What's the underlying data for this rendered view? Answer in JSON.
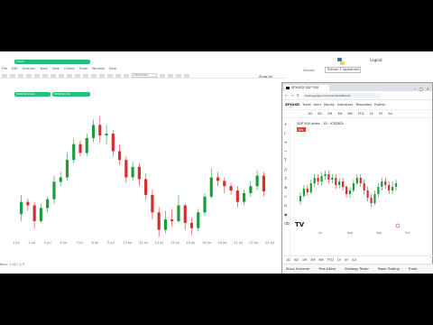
{
  "left_app": {
    "menu": [
      "File",
      "Edit",
      "Analysis",
      "Tools",
      "View",
      "Charts",
      "Trade",
      "Window",
      "Help"
    ],
    "interval_select": "Interactive",
    "show_all": "Show All",
    "pills": [
      "Chart",
      "EURUSD,Daily",
      "EURUSD,H4"
    ],
    "x_axis": [
      "1 Jul",
      "2 Jul",
      "5 Jul",
      "6 Jul",
      "7 Jul",
      "8 Jul",
      "9 Jul",
      "12 Jul",
      "13 Jul",
      "14 Jul",
      "15 Jul",
      "16 Jul",
      "19 Jul",
      "20 Jul",
      "21 Jul",
      "22 Jul",
      "23 Jul"
    ],
    "status": "Bars: 1.02 / 1.9"
  },
  "py_app": {
    "logout": "Logout",
    "label": "Session",
    "field_value": "Python 3 (ipykernel)"
  },
  "browser": {
    "tab_title": "SPXUSD S&P 500",
    "url": "tradingview.com/chart/4Oz9Ezu3/",
    "tv_symbol": "SPXUSD",
    "tv_header": [
      "Trade",
      "Alert",
      "Replay",
      "Indicators",
      "Templates",
      "Publish"
    ],
    "intervals": [
      "1D",
      "5D",
      "1M",
      "3M",
      "6M",
      "YTD",
      "1Y",
      "5Y",
      "All"
    ],
    "symbol_line": "S&P 500 Index · 1D · ICEDATA",
    "badge": "Sell",
    "x_labels": [
      "Jul",
      "Aug",
      "Sep",
      "Oct"
    ],
    "bottom_bar": [
      "1D",
      "5D",
      "1M",
      "3M",
      "6M",
      "YTD",
      "1Y",
      "5Y",
      "All"
    ],
    "footer": [
      "Stock Screener",
      "Pine Editor",
      "Strategy Tester",
      "Paper Trading",
      "Trade"
    ]
  },
  "colors": {
    "up": "#1a9c3f",
    "down": "#d32f2f",
    "pill": "#22c07a",
    "accent": "#2962ff"
  },
  "chart_data": [
    {
      "type": "candlestick",
      "name": "left-desktop-chart",
      "candles": [
        {
          "o": 38,
          "c": 52,
          "h": 60,
          "l": 30
        },
        {
          "o": 52,
          "c": 48,
          "h": 56,
          "l": 42
        },
        {
          "o": 48,
          "c": 30,
          "h": 52,
          "l": 22
        },
        {
          "o": 30,
          "c": 45,
          "h": 50,
          "l": 28
        },
        {
          "o": 45,
          "c": 55,
          "h": 58,
          "l": 40
        },
        {
          "o": 55,
          "c": 75,
          "h": 82,
          "l": 50
        },
        {
          "o": 75,
          "c": 80,
          "h": 86,
          "l": 70
        },
        {
          "o": 80,
          "c": 100,
          "h": 108,
          "l": 76
        },
        {
          "o": 100,
          "c": 118,
          "h": 124,
          "l": 96
        },
        {
          "o": 118,
          "c": 108,
          "h": 122,
          "l": 104
        },
        {
          "o": 108,
          "c": 125,
          "h": 130,
          "l": 104
        },
        {
          "o": 125,
          "c": 140,
          "h": 146,
          "l": 120
        },
        {
          "o": 140,
          "c": 128,
          "h": 150,
          "l": 120
        },
        {
          "o": 128,
          "c": 130,
          "h": 140,
          "l": 118
        },
        {
          "o": 130,
          "c": 110,
          "h": 134,
          "l": 104
        },
        {
          "o": 110,
          "c": 100,
          "h": 118,
          "l": 94
        },
        {
          "o": 100,
          "c": 80,
          "h": 104,
          "l": 74
        },
        {
          "o": 80,
          "c": 92,
          "h": 98,
          "l": 76
        },
        {
          "o": 92,
          "c": 78,
          "h": 96,
          "l": 70
        },
        {
          "o": 78,
          "c": 60,
          "h": 84,
          "l": 54
        },
        {
          "o": 60,
          "c": 40,
          "h": 66,
          "l": 32
        },
        {
          "o": 40,
          "c": 20,
          "h": 46,
          "l": 12
        },
        {
          "o": 20,
          "c": 32,
          "h": 42,
          "l": 16
        },
        {
          "o": 32,
          "c": 30,
          "h": 44,
          "l": 24
        },
        {
          "o": 30,
          "c": 48,
          "h": 60,
          "l": 28
        },
        {
          "o": 48,
          "c": 28,
          "h": 50,
          "l": 20
        },
        {
          "o": 28,
          "c": 22,
          "h": 34,
          "l": 14
        },
        {
          "o": 22,
          "c": 40,
          "h": 44,
          "l": 18
        },
        {
          "o": 40,
          "c": 58,
          "h": 62,
          "l": 36
        },
        {
          "o": 58,
          "c": 80,
          "h": 90,
          "l": 56
        },
        {
          "o": 80,
          "c": 76,
          "h": 86,
          "l": 70
        },
        {
          "o": 76,
          "c": 70,
          "h": 80,
          "l": 62
        },
        {
          "o": 70,
          "c": 65,
          "h": 74,
          "l": 60
        },
        {
          "o": 65,
          "c": 52,
          "h": 70,
          "l": 46
        },
        {
          "o": 52,
          "c": 62,
          "h": 66,
          "l": 48
        },
        {
          "o": 62,
          "c": 70,
          "h": 76,
          "l": 58
        },
        {
          "o": 70,
          "c": 82,
          "h": 88,
          "l": 66
        },
        {
          "o": 82,
          "c": 64,
          "h": 86,
          "l": 58
        }
      ],
      "ylim": [
        0,
        160
      ]
    },
    {
      "type": "candlestick",
      "name": "tradingview-mini-chart",
      "candles": [
        {
          "o": 40,
          "c": 46,
          "h": 50,
          "l": 36
        },
        {
          "o": 46,
          "c": 54,
          "h": 58,
          "l": 44
        },
        {
          "o": 54,
          "c": 50,
          "h": 58,
          "l": 46
        },
        {
          "o": 50,
          "c": 60,
          "h": 64,
          "l": 48
        },
        {
          "o": 60,
          "c": 66,
          "h": 70,
          "l": 56
        },
        {
          "o": 66,
          "c": 62,
          "h": 70,
          "l": 58
        },
        {
          "o": 62,
          "c": 68,
          "h": 72,
          "l": 58
        },
        {
          "o": 68,
          "c": 70,
          "h": 74,
          "l": 64
        },
        {
          "o": 70,
          "c": 64,
          "h": 74,
          "l": 60
        },
        {
          "o": 64,
          "c": 66,
          "h": 70,
          "l": 60
        },
        {
          "o": 66,
          "c": 58,
          "h": 70,
          "l": 54
        },
        {
          "o": 58,
          "c": 62,
          "h": 66,
          "l": 54
        },
        {
          "o": 62,
          "c": 56,
          "h": 66,
          "l": 52
        },
        {
          "o": 56,
          "c": 48,
          "h": 58,
          "l": 44
        },
        {
          "o": 48,
          "c": 52,
          "h": 56,
          "l": 44
        },
        {
          "o": 52,
          "c": 60,
          "h": 64,
          "l": 50
        },
        {
          "o": 60,
          "c": 66,
          "h": 70,
          "l": 58
        },
        {
          "o": 66,
          "c": 60,
          "h": 70,
          "l": 56
        },
        {
          "o": 60,
          "c": 52,
          "h": 64,
          "l": 48
        },
        {
          "o": 52,
          "c": 44,
          "h": 56,
          "l": 40
        },
        {
          "o": 44,
          "c": 38,
          "h": 48,
          "l": 34
        },
        {
          "o": 38,
          "c": 48,
          "h": 52,
          "l": 36
        },
        {
          "o": 48,
          "c": 56,
          "h": 60,
          "l": 44
        },
        {
          "o": 56,
          "c": 62,
          "h": 66,
          "l": 52
        },
        {
          "o": 62,
          "c": 58,
          "h": 66,
          "l": 54
        },
        {
          "o": 58,
          "c": 52,
          "h": 62,
          "l": 48
        },
        {
          "o": 52,
          "c": 56,
          "h": 62,
          "l": 48
        },
        {
          "o": 56,
          "c": 60,
          "h": 64,
          "l": 52
        }
      ],
      "ylim": [
        20,
        90
      ]
    }
  ]
}
